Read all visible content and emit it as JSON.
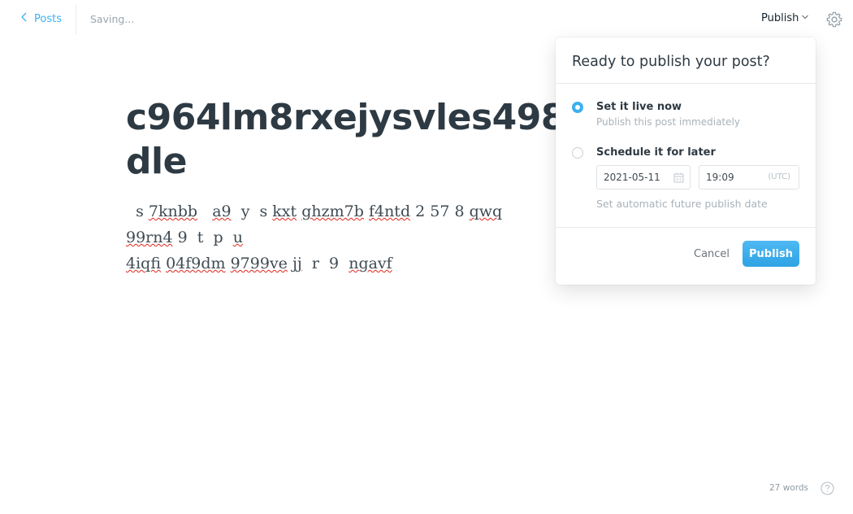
{
  "topbar": {
    "back_label": "Posts",
    "status": "Saving...",
    "publish_menu_label": "Publish"
  },
  "post": {
    "title": "c964lm8rxejysvles4985\ndle",
    "body_lines": [
      [
        "  s ",
        "7knbb",
        "   ",
        "a9",
        "  y  s ",
        "kxt",
        " ",
        "ghzm7b",
        " ",
        "f4ntd",
        " 2 57 8 ",
        "qwq",
        "    ",
        "99rn4",
        " 9  t  p  ",
        "u"
      ],
      [
        "4iqfi",
        " ",
        "04f9dm",
        " ",
        "9799ve",
        " ",
        "jj",
        "  r  9  ",
        "ngavf"
      ]
    ]
  },
  "publish_dialog": {
    "title": "Ready to publish your post?",
    "options": [
      {
        "title": "Set it live now",
        "description": "Publish this post immediately",
        "selected": true
      },
      {
        "title": "Schedule it for later",
        "description": "Set automatic future publish date",
        "selected": false
      }
    ],
    "date_value": "2021-05-11",
    "time_value": "19:09",
    "timezone": "(UTC)",
    "cancel_label": "Cancel",
    "publish_label": "Publish"
  },
  "footer": {
    "word_count": "27 words"
  },
  "colors": {
    "accent": "#3eb0ef",
    "text": "#2e3a43",
    "muted": "#a9b2b9",
    "spellcheck": "#e0251b"
  },
  "icons": {
    "back": "chevron-left-icon",
    "publish_menu": "chevron-down-icon",
    "settings": "gear-icon",
    "calendar": "calendar-icon",
    "help": "question-circle-icon"
  }
}
